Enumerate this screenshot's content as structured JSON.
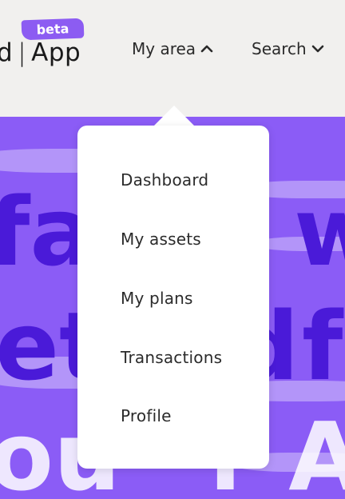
{
  "header": {
    "logo_prefix": "d",
    "logo_separator": "|",
    "logo_app": "App",
    "badge": "beta",
    "nav": [
      {
        "label": "My area",
        "icon": "chevron-up-icon"
      },
      {
        "label": "Search",
        "icon": "chevron-down-icon"
      }
    ]
  },
  "hero": {
    "line1_left": "fa",
    "line1_right": "w",
    "line2_left": "et",
    "line2_mid": "d",
    "line2_right": "fe",
    "line3_left": "ou",
    "line3_right": "r AI"
  },
  "menu": {
    "items": [
      "Dashboard",
      "My assets",
      "My plans",
      "Transactions",
      "Profile"
    ]
  },
  "colors": {
    "accent": "#8c5cf2",
    "hero_bg": "#8b5cf6",
    "hero_text": "#4a1ad8",
    "page_bg": "#f1f0ee"
  }
}
